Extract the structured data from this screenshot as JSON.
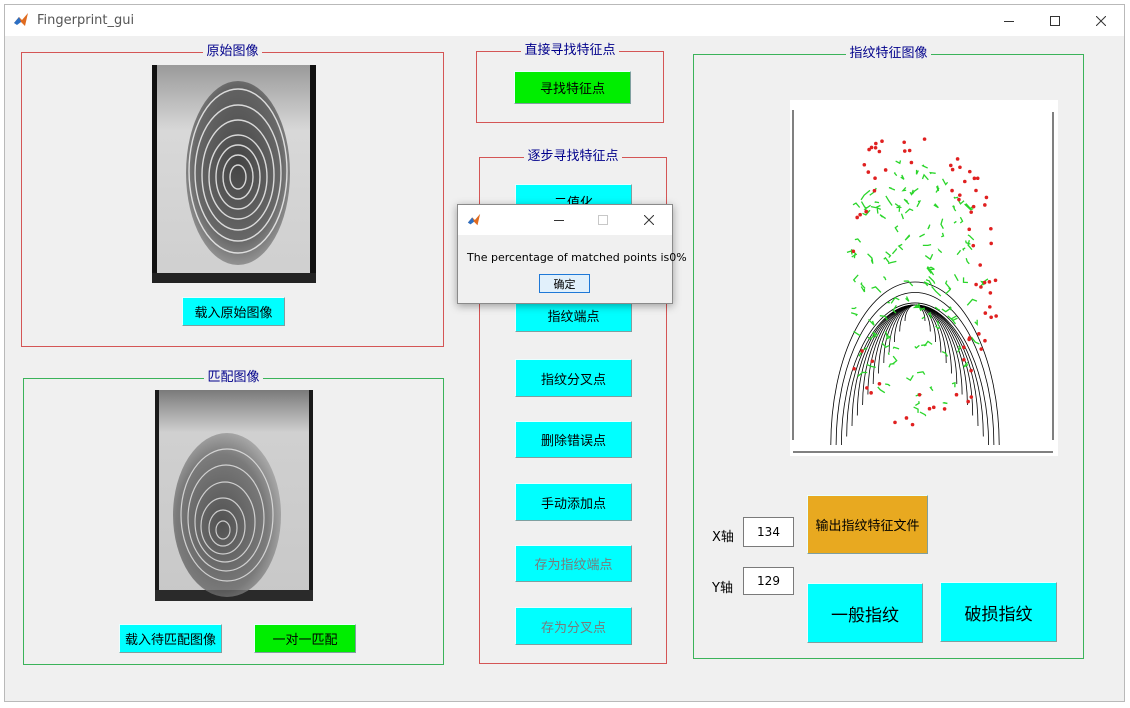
{
  "window": {
    "title": "Fingerprint_gui",
    "icon": "matlab-icon",
    "controls": [
      "minimize-icon",
      "maximize-icon",
      "close-icon"
    ]
  },
  "panels": {
    "original": {
      "title": "原始图像",
      "button": "载入原始图像"
    },
    "match": {
      "title": "匹配图像",
      "load_button": "载入待匹配图像",
      "match_button": "一对一匹配"
    },
    "direct": {
      "title": "直接寻找特征点",
      "button": "寻找特征点"
    },
    "step": {
      "title": "逐步寻找特征点",
      "buttons": [
        "二值化",
        "指纹端点",
        "指纹分叉点",
        "删除错误点",
        "手动添加点",
        "存为指纹端点",
        "存为分叉点"
      ]
    },
    "feature": {
      "title": "指纹特征图像",
      "x_label": "X轴",
      "x_value": "134",
      "y_label": "Y轴",
      "y_value": "129",
      "export_button": "输出指纹特征文件",
      "normal_button": "一般指纹",
      "damaged_button": "破损指纹"
    }
  },
  "dialog": {
    "icon": "matlab-icon",
    "message": "The percentage of matched points is0%",
    "ok_label": "确定"
  },
  "colors": {
    "cyan_button": "#00ffff",
    "green_button": "#00ee00",
    "orange_button": "#e8a920",
    "panel_title": "#00008b",
    "red_border": "#d45555",
    "green_border": "#3bb35a"
  }
}
